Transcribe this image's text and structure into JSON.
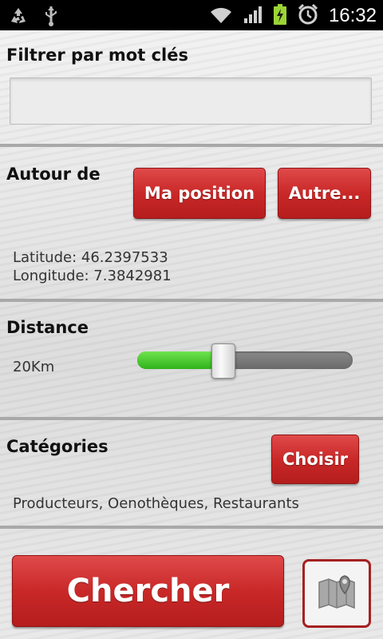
{
  "status_bar": {
    "time": "16:32",
    "icons": [
      "recycle-icon",
      "usb-icon",
      "wifi-icon",
      "signal-icon",
      "battery-charging-icon",
      "alarm-icon"
    ]
  },
  "filter": {
    "heading": "Filtrer par mot clés",
    "input_value": "",
    "placeholder": ""
  },
  "around": {
    "heading": "Autour de",
    "my_position_label": "Ma position",
    "other_label": "Autre...",
    "latitude_text": "Latitude: 46.2397533",
    "longitude_text": "Longitude: 7.3842981"
  },
  "distance": {
    "heading": "Distance",
    "value_text": "20Km",
    "slider_fraction": 0.4
  },
  "categories": {
    "heading": "Catégories",
    "choose_label": "Choisir",
    "selected_text": "Producteurs, Oenothèques, Restaurants"
  },
  "actions": {
    "search_label": "Chercher",
    "map_icon": "map-pin-icon"
  },
  "colors": {
    "accent_red": "#c92828",
    "slider_green": "#3fc126",
    "separator": "#a9a9a9"
  }
}
